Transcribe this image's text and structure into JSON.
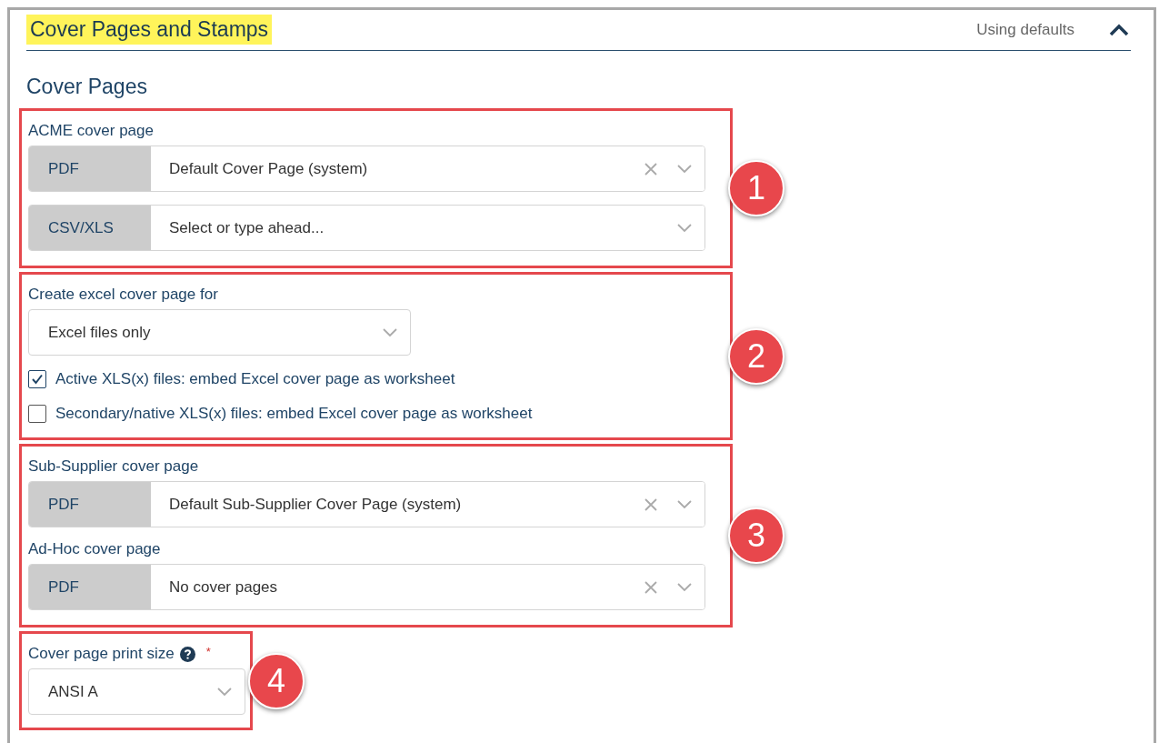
{
  "header": {
    "title": "Cover Pages and Stamps",
    "status": "Using defaults",
    "expanded": true
  },
  "section_title": "Cover Pages",
  "groups": [
    {
      "badge": "1",
      "items": [
        {
          "kind": "label",
          "text": "ACME cover page"
        },
        {
          "kind": "prefixed-select",
          "prefix": "PDF",
          "value": "Default Cover Page (system)",
          "clearable": true
        },
        {
          "kind": "prefixed-select",
          "prefix": "CSV/XLS",
          "placeholder": "Select or type ahead...",
          "clearable": false
        }
      ]
    },
    {
      "badge": "2",
      "items": [
        {
          "kind": "label",
          "text": "Create excel cover page for"
        },
        {
          "kind": "select",
          "value": "Excel files only"
        },
        {
          "kind": "checkbox",
          "text": "Active XLS(x) files: embed Excel cover page as worksheet",
          "checked": true
        },
        {
          "kind": "checkbox",
          "text": "Secondary/native XLS(x) files: embed Excel cover page as worksheet",
          "checked": false
        }
      ]
    },
    {
      "badge": "3",
      "items": [
        {
          "kind": "label",
          "text": "Sub-Supplier cover page"
        },
        {
          "kind": "prefixed-select",
          "prefix": "PDF",
          "value": "Default Sub-Supplier Cover Page (system)",
          "clearable": true
        },
        {
          "kind": "label",
          "text": "Ad-Hoc cover page"
        },
        {
          "kind": "prefixed-select",
          "prefix": "PDF",
          "value": "No cover pages",
          "clearable": true
        }
      ]
    },
    {
      "badge": "4",
      "items": [
        {
          "kind": "label",
          "text": "Cover page print size",
          "help": true,
          "required_mark": "*"
        },
        {
          "kind": "compact-select",
          "value": "ANSI A"
        }
      ]
    }
  ]
}
